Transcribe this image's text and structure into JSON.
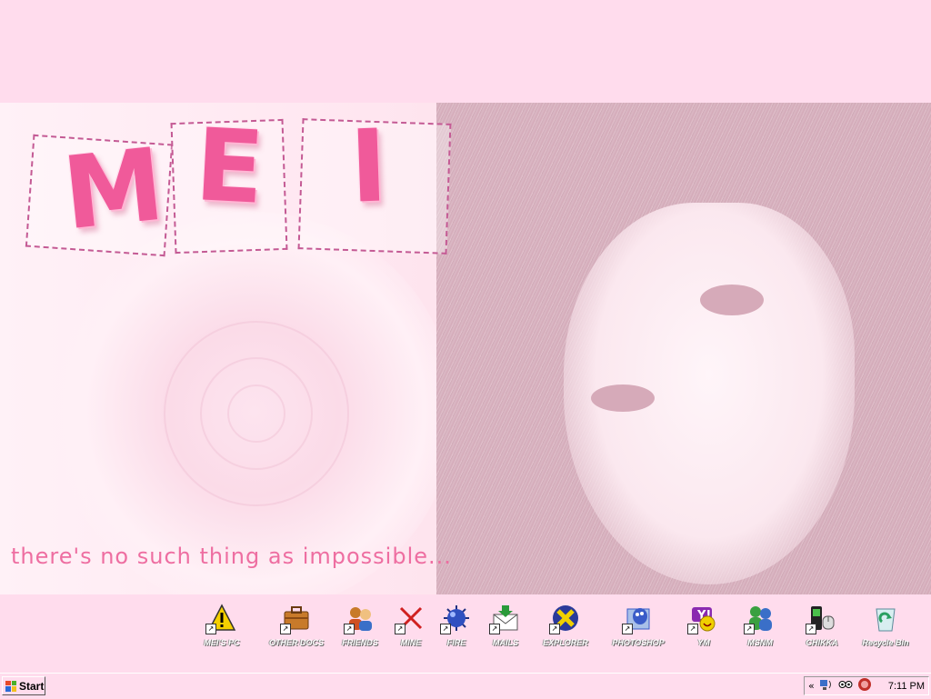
{
  "wallpaper": {
    "brand_letters": [
      "M",
      "E",
      "I"
    ],
    "tagline": "there's no such thing as impossible..."
  },
  "desktop_icons": [
    {
      "id": "meis-pc",
      "label": "MEI'S PC",
      "icon": "warning-icon",
      "color": "#f5d000"
    },
    {
      "id": "other-docs",
      "label": "OTHER DOCS",
      "icon": "briefcase-icon",
      "color": "#c87a2a"
    },
    {
      "id": "friends",
      "label": "FRIENDS",
      "icon": "users-icon",
      "color": "#3a6fc8"
    },
    {
      "id": "mine",
      "label": "MINE",
      "icon": "close-icon",
      "color": "#d02020"
    },
    {
      "id": "fire",
      "label": "FIRE",
      "icon": "mine-icon",
      "color": "#3050c0"
    },
    {
      "id": "mails",
      "label": "MAILS",
      "icon": "mail-icon",
      "color": "#2a9a3a"
    },
    {
      "id": "explorer",
      "label": "EXPLORER",
      "icon": "explorer-icon",
      "color": "#f0d000"
    },
    {
      "id": "photoshop",
      "label": "PHOTOSHOP",
      "icon": "photoshop-icon",
      "color": "#3a5cc8"
    },
    {
      "id": "ym",
      "label": "YM",
      "icon": "yahoo-messenger-icon",
      "color": "#8a2ab0"
    },
    {
      "id": "msnm",
      "label": "MSNM",
      "icon": "msn-messenger-icon",
      "color": "#3aa040"
    },
    {
      "id": "chikka",
      "label": "CHIKKA",
      "icon": "phone-icon",
      "color": "#2a8a2a"
    },
    {
      "id": "recycle-bin",
      "label": "Recycle Bin",
      "icon": "recycle-bin-icon",
      "color": "#2aa060"
    }
  ],
  "taskbar": {
    "start_label": "Start",
    "tray_chevron": "«",
    "clock": "7:11 PM"
  },
  "colors": {
    "background": "#ffdced",
    "accent": "#f05a9a"
  }
}
